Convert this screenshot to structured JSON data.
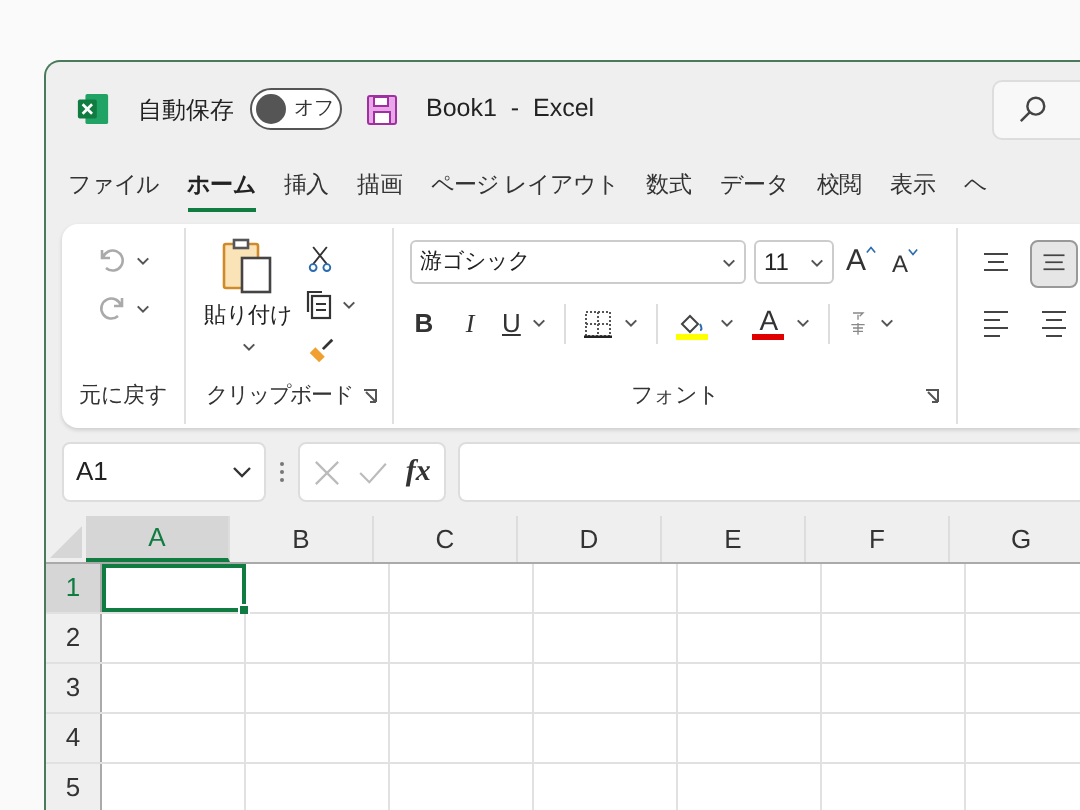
{
  "title_bar": {
    "autosave": {
      "label": "自動保存",
      "on": false,
      "state_text": "オフ"
    },
    "title": "Book1  -  Excel"
  },
  "tabs": [
    {
      "label": "ファイル",
      "selected": false
    },
    {
      "label": "ホーム",
      "selected": true
    },
    {
      "label": "挿入",
      "selected": false
    },
    {
      "label": "描画",
      "selected": false
    },
    {
      "label": "ページ レイアウト",
      "selected": false
    },
    {
      "label": "数式",
      "selected": false
    },
    {
      "label": "データ",
      "selected": false
    },
    {
      "label": "校閲",
      "selected": false
    },
    {
      "label": "表示",
      "selected": false
    },
    {
      "label": "ヘ",
      "selected": false
    }
  ],
  "ribbon": {
    "groups": [
      {
        "kind": "undo",
        "label": "元に戻す"
      },
      {
        "kind": "clipboard",
        "label": "クリップボード",
        "paste_label": "貼り付け"
      },
      {
        "kind": "font",
        "label": "フォント",
        "font_name": "游ゴシック",
        "font_size": "11",
        "grow": "A",
        "shrink": "A",
        "bold": "B",
        "italic": "I",
        "underline": "U",
        "font_color": "A"
      },
      {
        "kind": "alignment"
      }
    ]
  },
  "formula_bar": {
    "name_box": "A1",
    "function_label": "fx"
  },
  "grid": {
    "columns": [
      {
        "label": "A",
        "selected": true
      },
      {
        "label": "B",
        "selected": false
      },
      {
        "label": "C",
        "selected": false
      },
      {
        "label": "D",
        "selected": false
      },
      {
        "label": "E",
        "selected": false
      },
      {
        "label": "F",
        "selected": false
      },
      {
        "label": "G",
        "selected": false
      }
    ],
    "rows": [
      {
        "label": "1",
        "selected": true
      },
      {
        "label": "2",
        "selected": false
      },
      {
        "label": "3",
        "selected": false
      },
      {
        "label": "4",
        "selected": false
      },
      {
        "label": "5",
        "selected": false
      }
    ]
  }
}
